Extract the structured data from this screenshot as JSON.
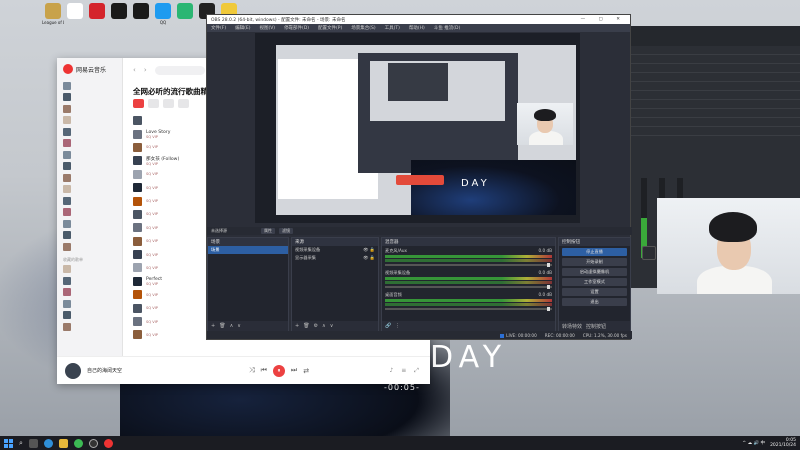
{
  "desktop": {
    "icons": [
      {
        "label": "League of Legends",
        "color": "#c8a24a"
      },
      {
        "label": "",
        "color": "#ffffff"
      },
      {
        "label": "",
        "color": "#d4242b"
      },
      {
        "label": "",
        "color": "#1a1a1a"
      },
      {
        "label": "",
        "color": "#1a1a1a"
      },
      {
        "label": "QQ",
        "color": "#1e9bf0"
      },
      {
        "label": "",
        "color": "#2bb673"
      },
      {
        "label": "",
        "color": "#222222"
      },
      {
        "label": "",
        "color": "#f0c93a"
      }
    ],
    "wallpaper_text": "DAY",
    "wallpaper_time": "-00:05-"
  },
  "music": {
    "app_name": "网易云音乐",
    "sidebar": {
      "items": [
        "",
        "",
        "",
        "",
        "",
        "",
        "",
        "",
        "",
        "",
        "",
        "",
        "",
        "",
        "",
        "",
        "",
        "",
        "",
        "",
        ""
      ],
      "section_label": "收藏的歌单"
    },
    "playlist_title": "全网必听的流行歌曲精选",
    "songs": [
      {
        "name": "",
        "artist": ""
      },
      {
        "name": "Love Story",
        "artist": "SQ VIP"
      },
      {
        "name": "",
        "artist": "SQ VIP"
      },
      {
        "name": "那女孩 (Follow)",
        "artist": "SQ VIP"
      },
      {
        "name": "",
        "artist": "SQ VIP"
      },
      {
        "name": "",
        "artist": "SQ VIP"
      },
      {
        "name": "",
        "artist": "SQ VIP"
      },
      {
        "name": "",
        "artist": "SQ VIP"
      },
      {
        "name": "",
        "artist": "SQ VIP"
      },
      {
        "name": "",
        "artist": "SQ VIP"
      },
      {
        "name": "",
        "artist": "SQ VIP"
      },
      {
        "name": "",
        "artist": "SQ VIP"
      },
      {
        "name": "Perfect",
        "artist": "SQ VIP"
      },
      {
        "name": "",
        "artist": "SQ VIP"
      },
      {
        "name": "",
        "artist": "SQ VIP"
      },
      {
        "name": "",
        "artist": "SQ VIP"
      },
      {
        "name": "",
        "artist": "SQ VIP"
      }
    ],
    "player": {
      "now_playing": "自己的海阔天空",
      "lyric": "",
      "controls": {
        "shuffle": "⤨",
        "prev": "⏮",
        "play": "⏸",
        "next": "⏭",
        "mode": "⇄"
      },
      "extras": "♪ ≡ ⤢"
    }
  },
  "obs": {
    "title": "OBS 28.0.2 (64-bit, windows) - 配置文件: 未命名 - 场景: 未命名",
    "window_buttons": "— ▢ ✕",
    "menu": [
      "文件(F)",
      "编辑(E)",
      "视图(V)",
      "停靠部件(D)",
      "配置文件(P)",
      "场景集合(S)",
      "工具(T)",
      "帮助(H)",
      "斗鱼 推流(D)"
    ],
    "nested_preview_text": "DAY",
    "status_strip": {
      "scene_label": "未选择源",
      "btn1": "属性",
      "btn2": "滤镜"
    },
    "docks": {
      "scenes": {
        "header": "场景",
        "items": [
          "场景"
        ]
      },
      "sources": {
        "header": "来源",
        "items": [
          "视频采集设备",
          "显示器采集"
        ]
      },
      "mixer": {
        "header": "混音器",
        "channels": [
          {
            "name": "麦克风/Aux",
            "db": "0.0 dB"
          },
          {
            "name": "视频采集设备",
            "db": "0.0 dB"
          },
          {
            "name": "桌面音频",
            "db": "0.0 dB"
          }
        ]
      },
      "controls": {
        "header": "控制按钮",
        "buttons": [
          "停止直播",
          "开始录制",
          "启动虚拟摄像机",
          "工作室模式",
          "设置",
          "退出"
        ],
        "tabs": [
          "转场特效",
          "控制按钮"
        ]
      }
    },
    "statusbar": {
      "live": "LIVE: 00:00:00",
      "rec": "REC: 00:00:00",
      "cpu": "CPU: 1.2%, 30.00 fps"
    }
  },
  "taskbar": {
    "search_glyph": "⌕",
    "clock_time": "0:05",
    "clock_date": "2021/10/24",
    "tray_icons": "^ ☁ 🔊 中"
  }
}
